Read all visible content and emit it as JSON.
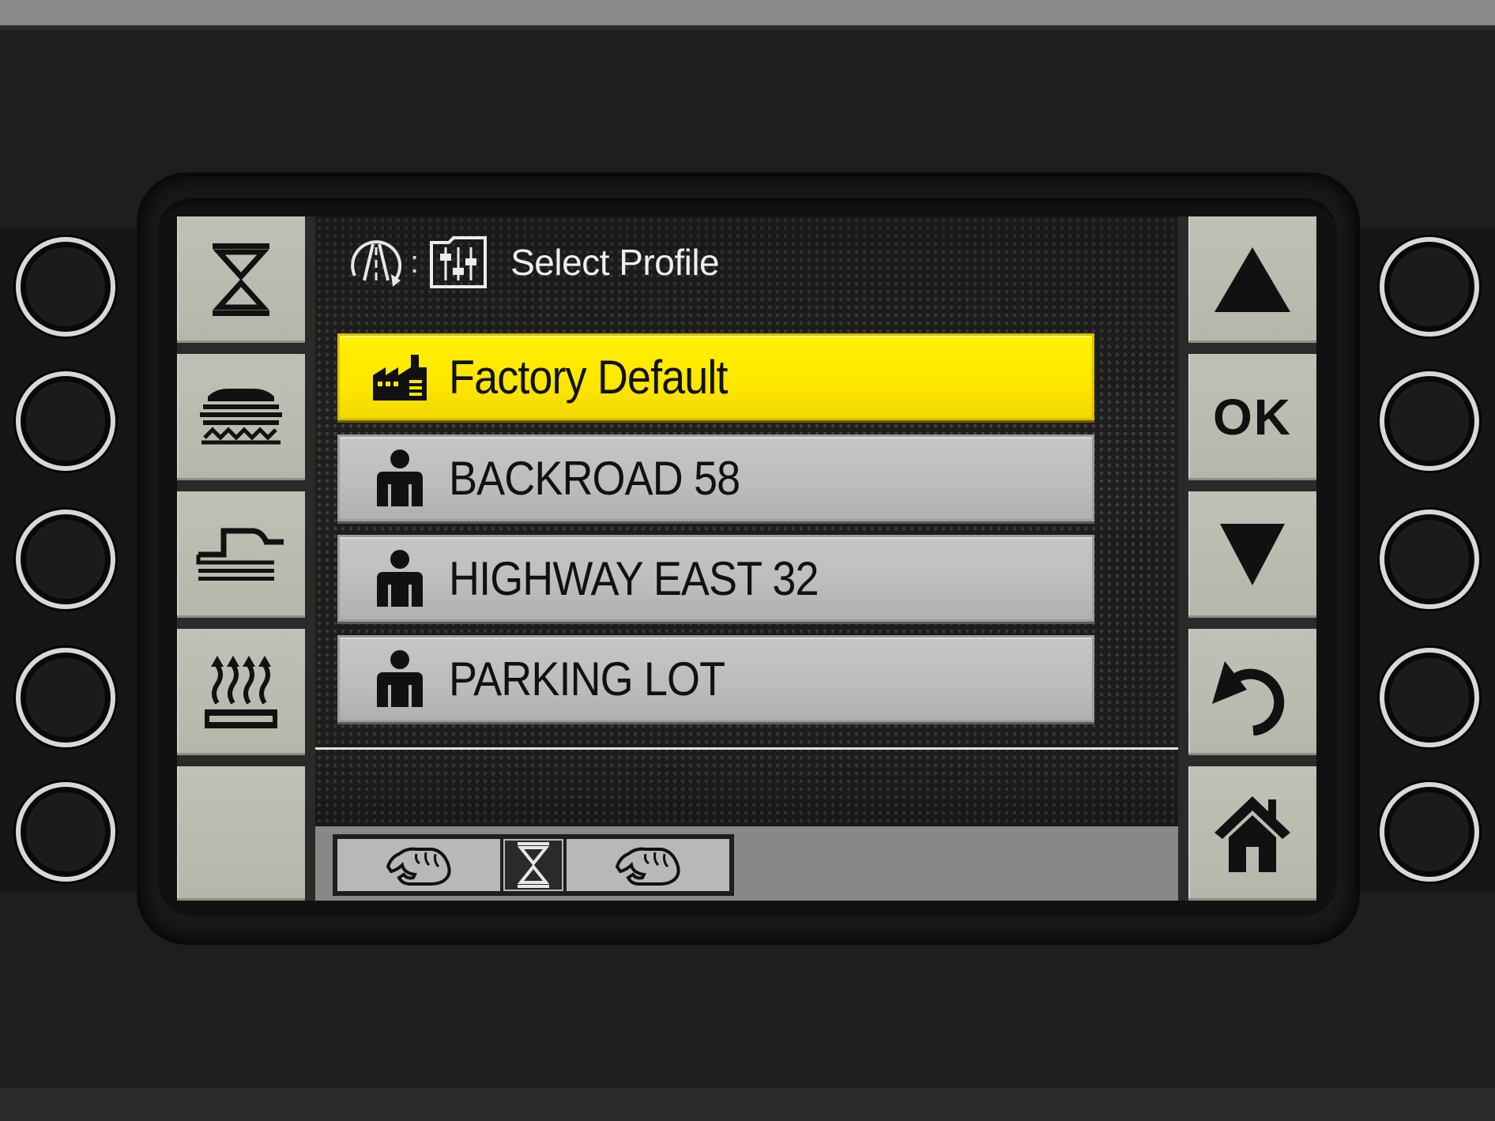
{
  "header": {
    "title": "Select Profile",
    "separator": ":",
    "icons": [
      "road-icon",
      "settings-folder-icon"
    ]
  },
  "profiles": [
    {
      "label": "Factory Default",
      "icon": "factory-icon",
      "selected": true
    },
    {
      "label": "BACKROAD 58",
      "icon": "person-icon",
      "selected": false
    },
    {
      "label": "HIGHWAY EAST 32",
      "icon": "person-icon",
      "selected": false
    },
    {
      "label": "PARKING LOT",
      "icon": "person-icon",
      "selected": false
    }
  ],
  "left_softkeys": [
    {
      "icon": "center-level-icon"
    },
    {
      "icon": "screed-extension-icon"
    },
    {
      "icon": "slope-icon"
    },
    {
      "icon": "heating-icon"
    },
    {
      "icon": "blank"
    }
  ],
  "right_softkeys": [
    {
      "icon": "arrow-up-icon"
    },
    {
      "label": "OK"
    },
    {
      "icon": "arrow-down-icon"
    },
    {
      "icon": "back-icon"
    },
    {
      "icon": "home-icon"
    }
  ],
  "footer_tabs": [
    "hand-left-icon",
    "center-level-icon",
    "hand-right-icon"
  ],
  "colors": {
    "selected_row": "#ffe600",
    "row": "#bcbcbc",
    "softkey": "#b8b8ac",
    "bezel": "#1e1e1e"
  }
}
